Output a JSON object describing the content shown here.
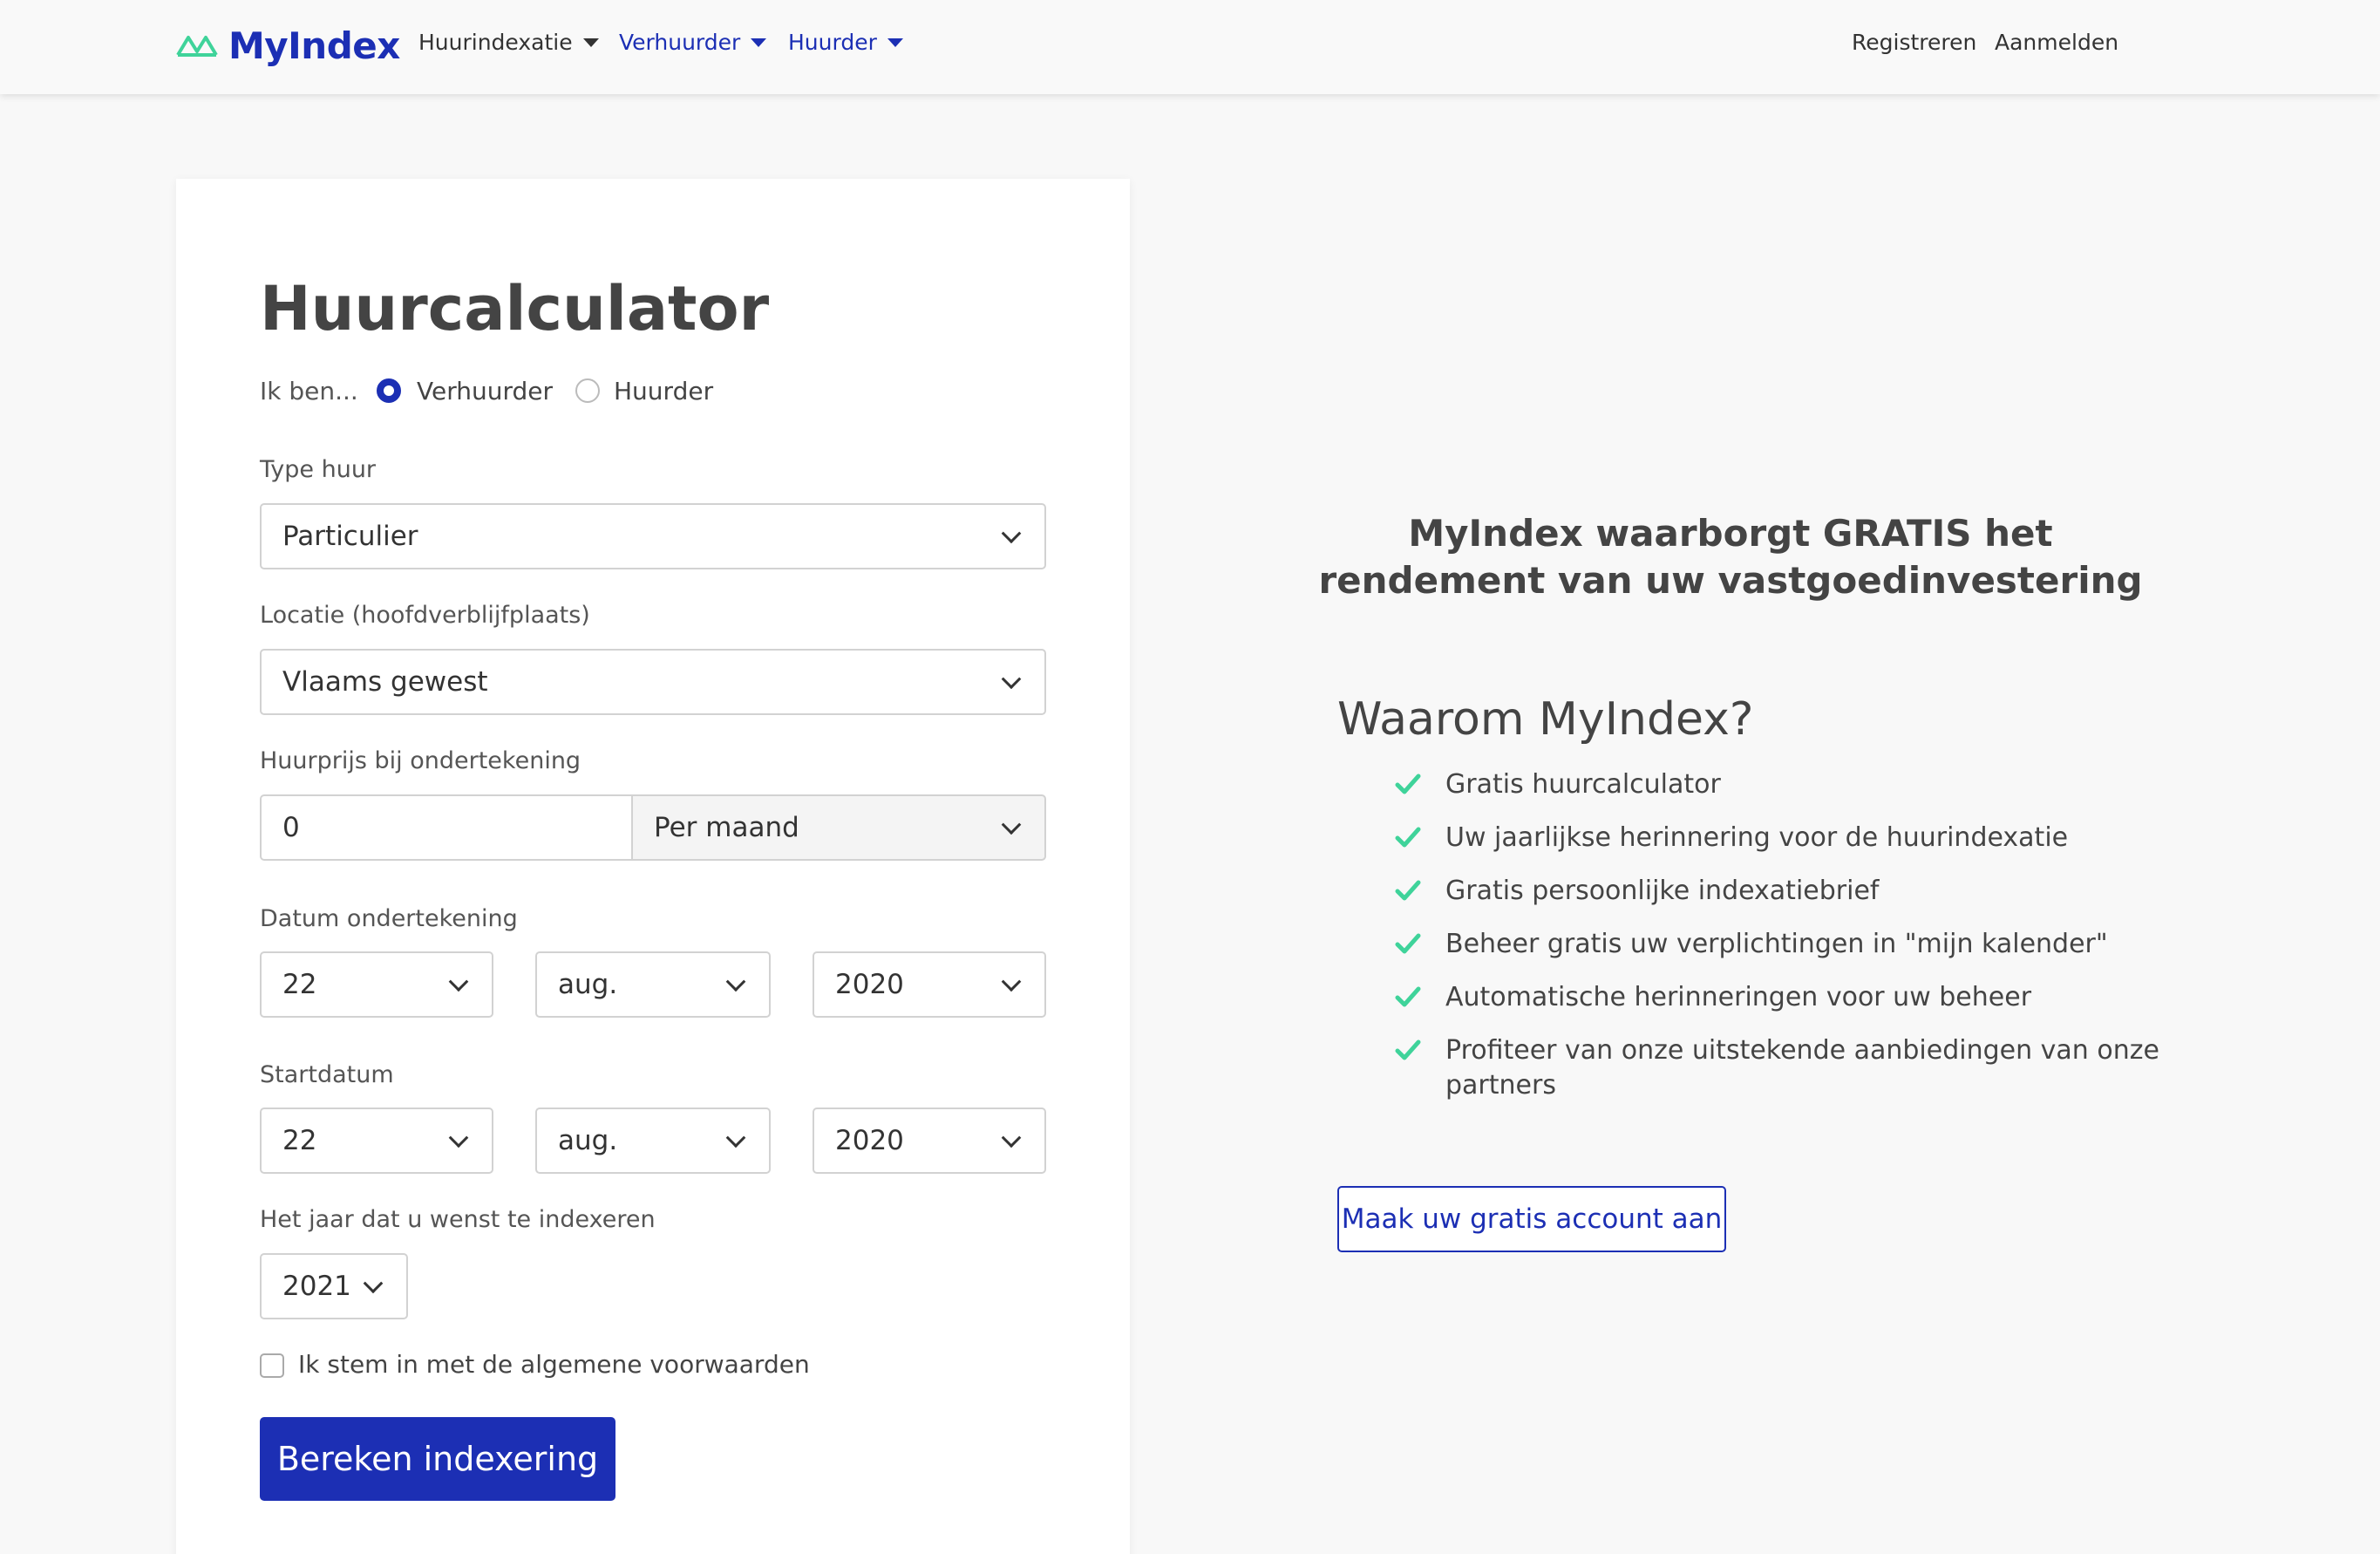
{
  "navbar": {
    "brand": "MyIndex",
    "menu": [
      {
        "label": "Huurindexatie"
      },
      {
        "label": "Verhuurder"
      },
      {
        "label": "Huurder"
      }
    ],
    "register": "Registreren",
    "login": "Aanmelden"
  },
  "calculator": {
    "title": "Huurcalculator",
    "role_label": "Ik ben...",
    "role_options": [
      "Verhuurder",
      "Huurder"
    ],
    "role_selected": "Verhuurder",
    "type_label": "Type huur",
    "type_value": "Particulier",
    "location_label": "Locatie (hoofdverblijfplaats)",
    "location_value": "Vlaams gewest",
    "price_label": "Huurprijs bij ondertekening",
    "price_value": "0",
    "period_value": "Per maand",
    "sign_date_label": "Datum ondertekening",
    "sign_date": {
      "day": "22",
      "month": "aug.",
      "year": "2020"
    },
    "start_date_label": "Startdatum",
    "start_date": {
      "day": "22",
      "month": "aug.",
      "year": "2020"
    },
    "index_year_label": "Het jaar dat u wenst te indexeren",
    "index_year": "2021",
    "terms_label": "Ik stem in met de algemene voorwaarden",
    "submit": "Bereken indexering"
  },
  "promo": {
    "headline_line1": "MyIndex waarborgt GRATIS het",
    "headline_line2": "rendement van uw vastgoedinvestering",
    "why_title": "Waarom MyIndex?",
    "benefits": [
      "Gratis huurcalculator",
      "Uw jaarlijkse herinnering voor de huurindexatie",
      "Gratis persoonlijke indexatiebrief",
      "Beheer gratis uw verplichtingen in \"mijn kalender\"",
      "Automatische herinneringen voor uw beheer",
      "Profiteer van onze uitstekende aanbiedingen van onze partners"
    ],
    "cta": "Maak uw gratis account aan"
  },
  "colors": {
    "brand_blue": "#1c2fb4",
    "check_green": "#3fd39a",
    "background": "#f8f8f8"
  }
}
